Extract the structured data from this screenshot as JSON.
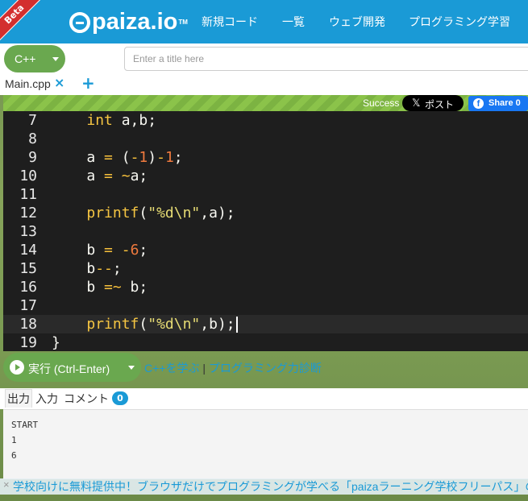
{
  "header": {
    "beta_label": "Beta",
    "logo_text": "paiza.io",
    "logo_tm": "TM",
    "nav": [
      "新規コード",
      "一覧",
      "ウェブ開発",
      "プログラミング学習"
    ],
    "background_color": "#1a9ad6"
  },
  "toolbar": {
    "language": "C++",
    "title_placeholder": "Enter a title here"
  },
  "files": {
    "tab_label": "Main.cpp",
    "close_icon": "×",
    "add_icon": "+"
  },
  "status": {
    "text": "Success",
    "x_post_label": "ポスト",
    "fb_share_label": "Share 0"
  },
  "editor": {
    "lines": [
      {
        "n": "7",
        "code": "    int a,b;"
      },
      {
        "n": "8",
        "code": ""
      },
      {
        "n": "9",
        "code": "    a = (-1)-1;"
      },
      {
        "n": "10",
        "code": "    a = ~a;"
      },
      {
        "n": "11",
        "code": ""
      },
      {
        "n": "12",
        "code": "    printf(\"%d\\n\",a);"
      },
      {
        "n": "13",
        "code": ""
      },
      {
        "n": "14",
        "code": "    b = -6;"
      },
      {
        "n": "15",
        "code": "    b--;"
      },
      {
        "n": "16",
        "code": "    b =~ b;"
      },
      {
        "n": "17",
        "code": ""
      },
      {
        "n": "18",
        "code": "    printf(\"%d\\n\",b);"
      },
      {
        "n": "19",
        "code": "}"
      }
    ],
    "active_line": "18"
  },
  "run": {
    "button_label": "実行 (Ctrl-Enter)",
    "learn_link": "C++を学ぶ",
    "separator": "|",
    "diagnosis_link": "プログラミング力診断"
  },
  "output_tabs": {
    "output": "出力",
    "input": "入力",
    "comment": "コメント",
    "comment_count": "0"
  },
  "output": {
    "lines": [
      "START",
      "1",
      "6"
    ]
  },
  "banner": {
    "close": "×",
    "text": "学校向けに無料提供中！ブラウザだけでプログラミングが学べる「paizaラーニング学校フリーパス」の"
  }
}
